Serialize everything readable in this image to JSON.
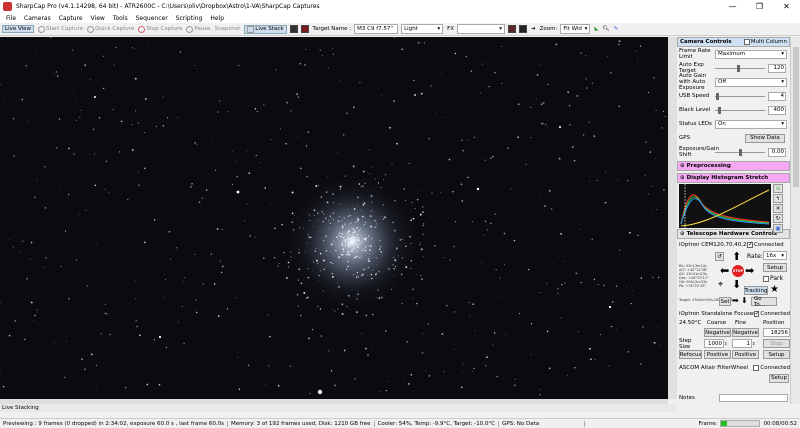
{
  "window": {
    "title": "SharpCap Pro (v4.1.14298, 64 bit) - ATR2600C - C:\\Users\\oliv\\Dropbox\\Astro\\1-VA\\SharpCap Captures",
    "minimize": "—",
    "maximize": "❐",
    "close": "✕"
  },
  "menu": [
    "File",
    "Cameras",
    "Capture",
    "View",
    "Tools",
    "Sequencer",
    "Scripting",
    "Help"
  ],
  "toolbar": {
    "live_view": "Live View",
    "start_capture": "Start Capture",
    "quick_capture": "Quick Capture",
    "stop_capture": "Stop Capture",
    "pause": "Pause",
    "snapshot": "Snapshot",
    "live_stack": "Live Stack",
    "target_name_label": "Target Name :",
    "target_name_value": "M3 C9 f7.57“",
    "frame_type": "Light",
    "fx_label": "FX",
    "fx_value": "",
    "zoom_label": "Zoom:",
    "zoom_value": "Fit Wid"
  },
  "panel": {
    "camera_controls": "Camera Controls",
    "multi_column": "Multi Column",
    "rows": [
      {
        "label": "Frame Rate Limit",
        "value": "Maximum"
      },
      {
        "label": "Auto Exp Target",
        "value": "120"
      },
      {
        "label": "Auto Gain with Auto Exposure",
        "value": "Off"
      },
      {
        "label": "USB Speed",
        "value": "4"
      },
      {
        "label": "Black Level",
        "value": "400"
      },
      {
        "label": "Status LEDs",
        "value": "On"
      },
      {
        "label": "GPS",
        "value": "Show Data"
      },
      {
        "label": "Exposure/Gain Shift",
        "value": "0.00"
      }
    ],
    "preprocessing": "Preprocessing",
    "histogram": "Display Histogram Stretch",
    "telescope": {
      "header": "Telescope Hardware Controls",
      "mount": "iOptron CEM120,70,40,26, ...",
      "connected": "Connected",
      "rate_label": "Rate:",
      "rate_value": "16x",
      "setup": "Setup",
      "park": "Park",
      "stop": "STOP",
      "tracking": "Tracking",
      "set": "Set",
      "goto": "Go To...",
      "coords": [
        "RA: 03h13m14s",
        "ALT: +45°12'38\"",
        "AZ: 13h41m23s",
        "Dec: +28°23'11\"",
        "HA: 00h12m33s",
        "PA: +55°22'43\""
      ],
      "target_line": "Target: 13h42m03s,28m23s41s"
    },
    "focuser": {
      "name": "iOptron Standalone Focuser",
      "connected": "Connected",
      "temp": "24.50°C",
      "coarse": "Coarse",
      "fine": "Fine",
      "position_label": "Position",
      "negative": "Negative",
      "position_value": "18256",
      "step_label": "Step Size",
      "step_value": "1000",
      "fine_value": "1",
      "stop": "Stop",
      "refocus": "Refocus",
      "positive": "Positive",
      "setup": "Setup"
    },
    "filterwheel": {
      "name": "ASCOM Altair FilterWheel",
      "connected": "Connected",
      "setup": "Setup"
    },
    "notes": "Notes"
  },
  "live_stacking": "Live Stacking",
  "status": {
    "previewing": "Previewing : 9 frames (0 dropped) in 2:34:02, exposure 60.0 s , last frame 60.0s",
    "memory": "Memory: 3 of 192 frames used, Disk: 1210 GB free",
    "cooler": "Cooler: 54%, Temp: -9.9°C, Target: -10.0°C",
    "gps": "GPS: No Data",
    "frame_label": "Frame:",
    "frame_progress": 0.15,
    "elapsed": "00:08/00:52"
  },
  "colors": {
    "accent_blue": "#cfe0f4",
    "accent_pink": "#f7a8f3",
    "stop_red": "#e02020",
    "green_progress": "#22c022"
  }
}
